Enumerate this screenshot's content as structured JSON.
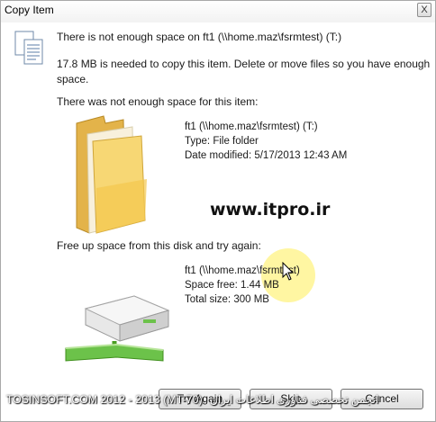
{
  "window": {
    "title": "Copy Item",
    "close_glyph": "X"
  },
  "message": {
    "heading": "There is not enough space on ft1 (\\\\home.maz\\fsrmtest) (T:)",
    "detail_line1": "17.8 MB is needed to copy this item. Delete or move files so you have enough",
    "detail_line2": "space."
  },
  "item_section": {
    "label": "There was not enough space for this item:",
    "name": "ft1 (\\\\home.maz\\fsrmtest) (T:)",
    "type": "Type: File folder",
    "date_modified": "Date modified: 5/17/2013 12:43 AM",
    "icon": "folder-icon"
  },
  "watermark": "www.itpro.ir",
  "free_space_section": {
    "label": "Free up space from this disk and try again:",
    "name": "ft1 (\\\\home.maz\\fsrmtest)",
    "space_free": "Space free: 1.44 MB",
    "total_size": "Total size: 300 MB",
    "icon": "network-drive-icon"
  },
  "buttons": {
    "try_again": "Try Again",
    "skip": "Skip",
    "cancel": "Cancel"
  },
  "footer": {
    "left": "TOSINSOFT.COM 2012 - 2013 (MT-70)",
    "right": "انجمن تخصصی فناوری اطلاعات ایران"
  },
  "colors": {
    "folder": "#f2c94c",
    "drive_accent": "#5ab52a",
    "highlight": "#fff27a"
  }
}
